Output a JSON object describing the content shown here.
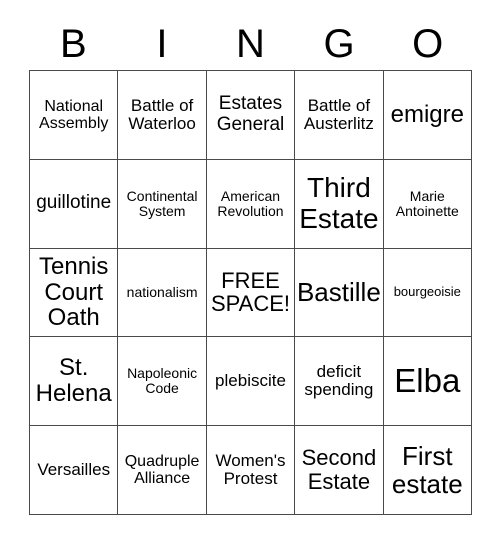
{
  "card": {
    "title_letters": [
      "B",
      "I",
      "N",
      "G",
      "O"
    ],
    "free_space_label": "FREE SPACE!",
    "free_space_position": {
      "row": 3,
      "col": 3
    },
    "grid_rows": 5,
    "grid_cols": 5,
    "border_color": "#4a4a4a",
    "background_color": "#ffffff",
    "text_color": "#000000",
    "rows": [
      [
        {
          "text": "National Assembly",
          "size": "m"
        },
        {
          "text": "Battle of Waterloo",
          "size": "ml"
        },
        {
          "text": "Estates General",
          "size": "l"
        },
        {
          "text": "Battle of Austerlitz",
          "size": "ml"
        },
        {
          "text": "emigre",
          "size": "2xl"
        }
      ],
      [
        {
          "text": "guillotine",
          "size": "l"
        },
        {
          "text": "Continental System",
          "size": "s"
        },
        {
          "text": "American Revolution",
          "size": "s"
        },
        {
          "text": "Third Estate",
          "size": "4xl"
        },
        {
          "text": "Marie Antoinette",
          "size": "s"
        }
      ],
      [
        {
          "text": "Tennis Court Oath",
          "size": "2xl"
        },
        {
          "text": "nationalism",
          "size": "s"
        },
        {
          "text": "FREE SPACE!",
          "size": "xl"
        },
        {
          "text": "Bastille",
          "size": "3xl"
        },
        {
          "text": "bourgeoisie",
          "size": "xs"
        }
      ],
      [
        {
          "text": "St. Helena",
          "size": "2xl"
        },
        {
          "text": "Napoleonic Code",
          "size": "s"
        },
        {
          "text": "plebiscite",
          "size": "ml"
        },
        {
          "text": "deficit spending",
          "size": "ml"
        },
        {
          "text": "Elba",
          "size": "5xl"
        }
      ],
      [
        {
          "text": "Versailles",
          "size": "ml"
        },
        {
          "text": "Quadruple Alliance",
          "size": "m"
        },
        {
          "text": "Women's Protest",
          "size": "ml"
        },
        {
          "text": "Second Estate",
          "size": "xl"
        },
        {
          "text": "First estate",
          "size": "3xl"
        }
      ]
    ]
  }
}
